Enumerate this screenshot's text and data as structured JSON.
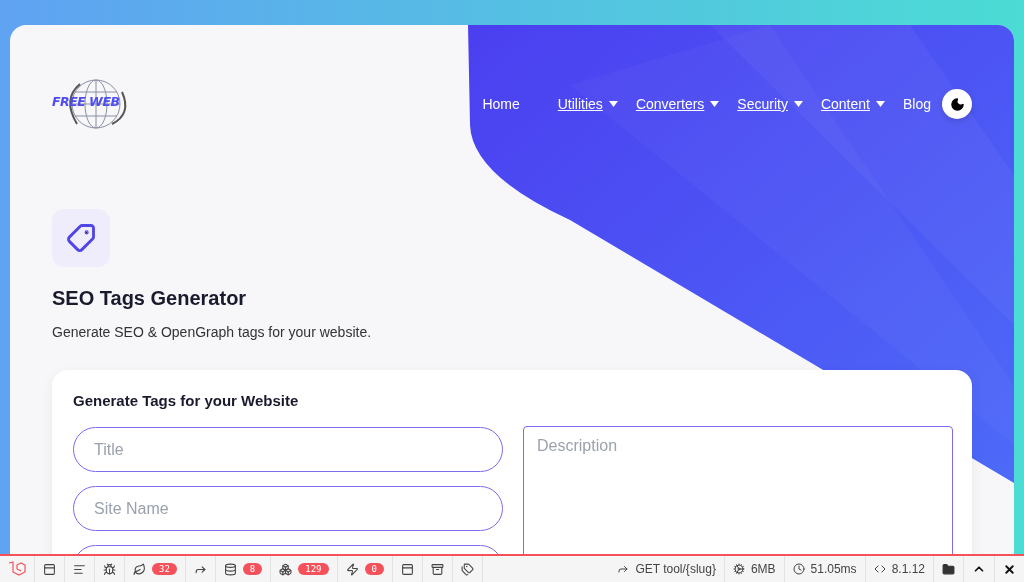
{
  "logo": {
    "text": "FREE WEB"
  },
  "nav": [
    {
      "label": "Home",
      "dropdown": false
    },
    {
      "label": "Utilities",
      "dropdown": true
    },
    {
      "label": "Converters",
      "dropdown": true
    },
    {
      "label": "Security",
      "dropdown": true
    },
    {
      "label": "Content",
      "dropdown": true
    },
    {
      "label": "Blog",
      "dropdown": false
    }
  ],
  "tool": {
    "title": "SEO Tags Generator",
    "subtitle": "Generate SEO & OpenGraph tags for your website."
  },
  "form": {
    "title": "Generate Tags for your Website",
    "left_fields": [
      {
        "kind": "input",
        "placeholder": "Title"
      },
      {
        "kind": "input",
        "placeholder": "Site Name"
      },
      {
        "kind": "input"
      }
    ],
    "right_fields": [
      {
        "kind": "textarea",
        "placeholder": "Description"
      }
    ]
  },
  "debugbar": {
    "items": [
      {
        "kind": "logo"
      },
      {
        "kind": "messages"
      },
      {
        "kind": "timeline"
      },
      {
        "kind": "exceptions"
      },
      {
        "kind": "views",
        "badge": "32"
      },
      {
        "kind": "route"
      },
      {
        "kind": "queries",
        "badge": "8"
      },
      {
        "kind": "models",
        "badge": "129"
      },
      {
        "kind": "events",
        "badge": "0"
      },
      {
        "kind": "request"
      },
      {
        "kind": "session"
      },
      {
        "kind": "tags"
      }
    ],
    "route": "GET tool/{slug}",
    "memory": "6MB",
    "time": "51.05ms",
    "php": "8.1.12"
  }
}
